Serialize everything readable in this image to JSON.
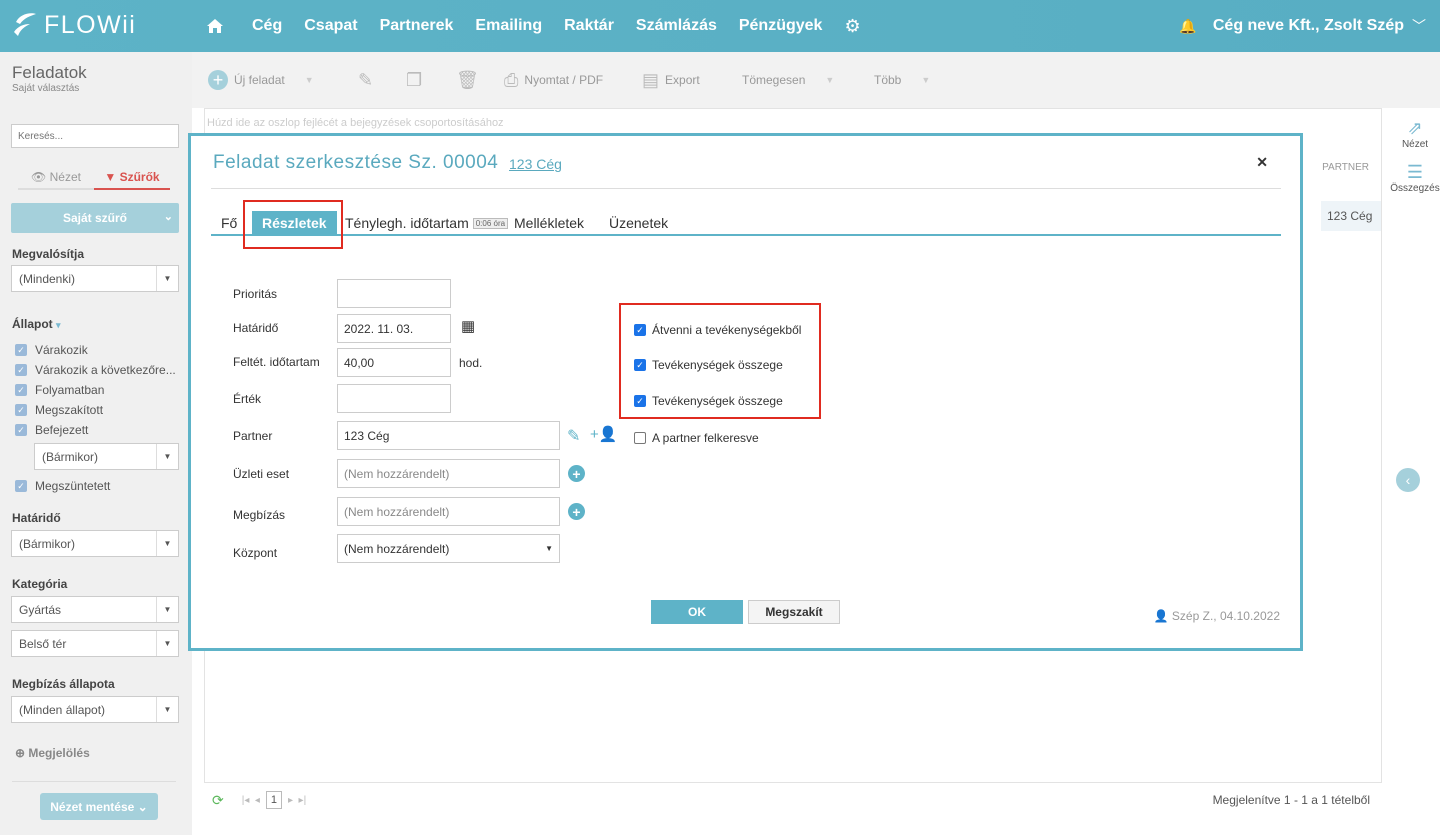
{
  "header": {
    "logo": "FLOWii",
    "nav": [
      "Cég",
      "Csapat",
      "Partnerek",
      "Emailing",
      "Raktár",
      "Számlázás",
      "Pénzügyek"
    ],
    "user": "Cég neve Kft., Zsolt Szép"
  },
  "sidebar": {
    "title": "Feladatok",
    "subtitle": "Saját választás",
    "search_placeholder": "Keresés...",
    "tab_view": "Nézet",
    "tab_filters": "Szűrők",
    "own_filter": "Saját szűrő",
    "realization_label": "Megvalósítja",
    "realization_value": "(Mindenki)",
    "state_label": "Állapot",
    "states": [
      "Várakozik",
      "Várakozik a következőre...",
      "Folyamatban",
      "Megszakított",
      "Befejezett"
    ],
    "finished_when": "(Bármikor)",
    "cancelled": "Megszüntetett",
    "deadline_label": "Határidő",
    "deadline_value": "(Bármikor)",
    "category_label": "Kategória",
    "category_values": [
      "Gyártás",
      "Belső tér"
    ],
    "order_state_label": "Megbízás állapota",
    "order_state_value": "(Minden állapot)",
    "mark_label": "Megjelölés",
    "save_view": "Nézet mentése"
  },
  "toolbar": {
    "new_task": "Új feladat",
    "print": "Nyomtat / PDF",
    "export": "Export",
    "bulk": "Tömegesen",
    "more": "Több"
  },
  "grid": {
    "group_hint": "Húzd ide az oszlop fejlécét a bejegyzések csoportosításához",
    "col_partner": "PARTNER",
    "cell_partner": "123 Cég",
    "page": "1",
    "info": "Megjelenítve 1 - 1 a 1 tételből"
  },
  "rail": {
    "view": "Nézet",
    "summary": "Összegzés"
  },
  "dialog": {
    "title": "Feladat szerkesztése Sz. 00004",
    "partner_link": "123 Cég",
    "tabs": {
      "main": "Fő",
      "details": "Részletek",
      "actual": "Ténylegh. időtartam",
      "actual_badge": "0:06 óra",
      "attachments": "Mellékletek",
      "messages": "Üzenetek"
    },
    "fields": {
      "priority_label": "Prioritás",
      "priority_value": "",
      "deadline_label": "Határidő",
      "deadline_value": "2022. 11. 03.",
      "est_label": "Feltét. időtartam",
      "est_value": "40,00",
      "est_unit": "hod.",
      "value_label": "Érték",
      "value_value": "",
      "partner_label": "Partner",
      "partner_value": "123  Cég",
      "deal_label": "Üzleti eset",
      "deal_value": "(Nem hozzárendelt)",
      "order_label": "Megbízás",
      "order_value": "(Nem hozzárendelt)",
      "center_label": "Központ",
      "center_value": "(Nem hozzárendelt)"
    },
    "checks": [
      {
        "label": "Átvenni a tevékenységekből",
        "checked": true
      },
      {
        "label": "Tevékenységek összege",
        "checked": true
      },
      {
        "label": "Tevékenységek összege",
        "checked": true
      },
      {
        "label": "A partner felkeresve",
        "checked": false
      }
    ],
    "ok": "OK",
    "cancel": "Megszakít",
    "audit": "Szép Z., 04.10.2022"
  }
}
